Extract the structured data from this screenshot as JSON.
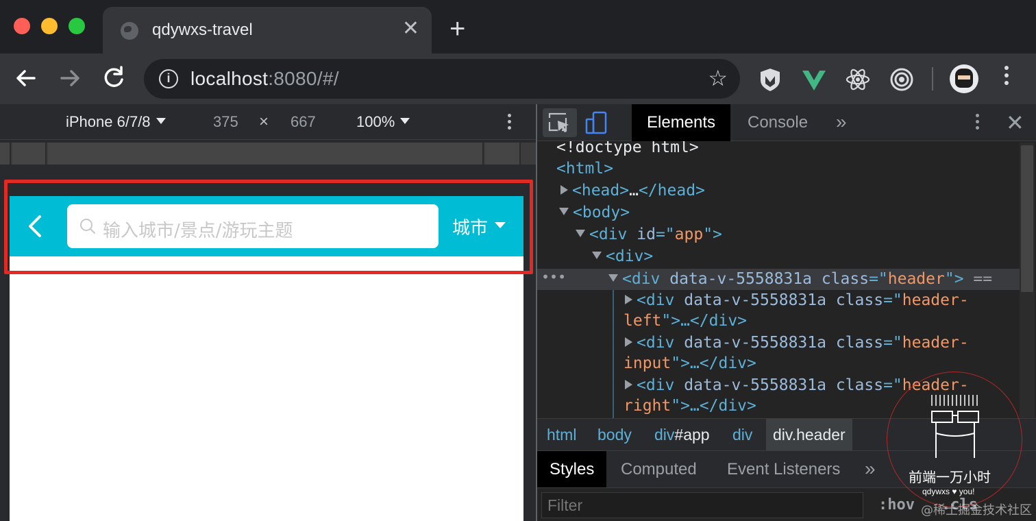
{
  "browser": {
    "tab_title": "qdywxs-travel",
    "url_host": "localhost",
    "url_rest": ":8080/#/",
    "extensions": [
      "shield-extension-icon",
      "vue-devtools-icon",
      "react-devtools-icon",
      "target-extension-icon"
    ]
  },
  "device_toolbar": {
    "device": "iPhone 6/7/8",
    "width": "375",
    "times": "×",
    "height": "667",
    "zoom": "100%"
  },
  "app": {
    "search_placeholder": "输入城市/景点/游玩主题",
    "city_label": "城市",
    "header_color": "#00bcd4",
    "highlight_color": "#e12a24"
  },
  "devtools": {
    "tabs": [
      "Elements",
      "Console"
    ],
    "more": "»",
    "dom": {
      "doctype": "<!doctype html>",
      "html_open": "<html>",
      "head": [
        "<head>",
        "…",
        "</head>"
      ],
      "body_open": "<body>",
      "div_app": [
        "<div ",
        "id",
        "=\"",
        "app",
        "\">"
      ],
      "div_plain": "<div>",
      "selected": {
        "dots": "•••",
        "open": "<div ",
        "attr": "data-v-5558831a ",
        "cls": "class",
        "eq": "=\"",
        "val": "header",
        "close": "\">",
        "suffix": " =="
      },
      "children": [
        {
          "l1_open": "<div ",
          "l1_attr": "data-v-5558831a ",
          "l1_cls": "class",
          "l1_eq": "=\"",
          "l1_val": "header-",
          "l2_val": "left",
          "l2_rest": "\">…</div>"
        },
        {
          "l1_open": "<div ",
          "l1_attr": "data-v-5558831a ",
          "l1_cls": "class",
          "l1_eq": "=\"",
          "l1_val": "header-",
          "l2_val": "input",
          "l2_rest": "\">…</div>"
        },
        {
          "l1_open": "<div ",
          "l1_attr": "data-v-5558831a ",
          "l1_cls": "class",
          "l1_eq": "=\"",
          "l1_val": "header-",
          "l2_val": "right",
          "l2_rest": "\">…</div>"
        }
      ]
    },
    "breadcrumbs": [
      {
        "text": "html"
      },
      {
        "text": "body"
      },
      {
        "text": "div",
        "id": "#app"
      },
      {
        "text": "div"
      },
      {
        "text": "div.header"
      }
    ],
    "sub_tabs": [
      "Styles",
      "Computed",
      "Event Listeners"
    ],
    "sub_more": "»",
    "filter_placeholder": "Filter",
    "hov": ":hov",
    "cls": ".cls"
  },
  "watermark": {
    "title": "前端一万小时",
    "subtitle": "qdywxs ♥ you!",
    "site": "@稀土掘金技术社区"
  }
}
